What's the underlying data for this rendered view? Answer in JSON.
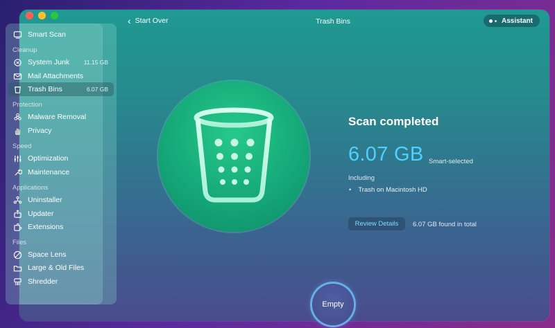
{
  "window": {
    "back_label": "Start Over",
    "title": "Trash Bins",
    "assistant_label": "Assistant"
  },
  "sidebar": {
    "smart_scan": "Smart Scan",
    "sections": {
      "cleanup": "Cleanup",
      "protection": "Protection",
      "speed": "Speed",
      "applications": "Applications",
      "files": "Files"
    },
    "items": {
      "system_junk": {
        "label": "System Junk",
        "size": "11.15 GB"
      },
      "mail_attachments": {
        "label": "Mail Attachments"
      },
      "trash_bins": {
        "label": "Trash Bins",
        "size": "6.07 GB"
      },
      "malware_removal": {
        "label": "Malware Removal"
      },
      "privacy": {
        "label": "Privacy"
      },
      "optimization": {
        "label": "Optimization"
      },
      "maintenance": {
        "label": "Maintenance"
      },
      "uninstaller": {
        "label": "Uninstaller"
      },
      "updater": {
        "label": "Updater"
      },
      "extensions": {
        "label": "Extensions"
      },
      "space_lens": {
        "label": "Space Lens"
      },
      "large_old_files": {
        "label": "Large & Old Files"
      },
      "shredder": {
        "label": "Shredder"
      }
    }
  },
  "result": {
    "title": "Scan completed",
    "size": "6.07 GB",
    "size_note": "Smart-selected",
    "including_label": "Including",
    "bullet": "•",
    "including_item": "Trash on Macintosh HD",
    "review_label": "Review Details",
    "found_text": "6.07 GB found in total"
  },
  "action": {
    "empty_label": "Empty"
  },
  "colors": {
    "accent_size": "#4fd1ff",
    "hero_green": "#15a878",
    "review_text": "#7fdcff"
  }
}
